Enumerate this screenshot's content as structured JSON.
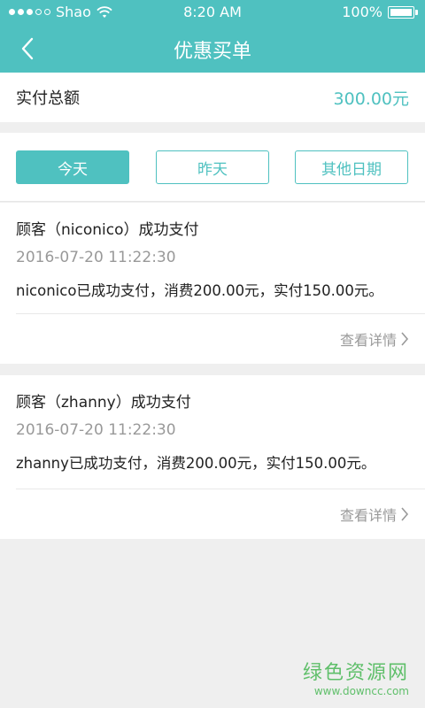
{
  "status_bar": {
    "carrier": "Shao",
    "time": "8:20 AM",
    "battery": "100%"
  },
  "nav": {
    "title": "优惠买单"
  },
  "summary": {
    "label": "实付总额",
    "amount": "300.00元"
  },
  "tabs": [
    {
      "label": "今天",
      "active": true
    },
    {
      "label": "昨天",
      "active": false
    },
    {
      "label": "其他日期",
      "active": false
    }
  ],
  "records": [
    {
      "title": "顾客（niconico）成功支付",
      "time": "2016-07-20 11:22:30",
      "desc": "niconico已成功支付，消费200.00元，实付150.00元。",
      "link": "查看详情"
    },
    {
      "title": "顾客（zhanny）成功支付",
      "time": "2016-07-20 11:22:30",
      "desc": "zhanny已成功支付，消费200.00元，实付150.00元。",
      "link": "查看详情"
    }
  ],
  "watermark": {
    "title": "绿色资源网",
    "url": "www.downcc.com"
  },
  "colors": {
    "accent": "#4fc1c0",
    "background": "#efefef",
    "muted_text": "#999999"
  }
}
